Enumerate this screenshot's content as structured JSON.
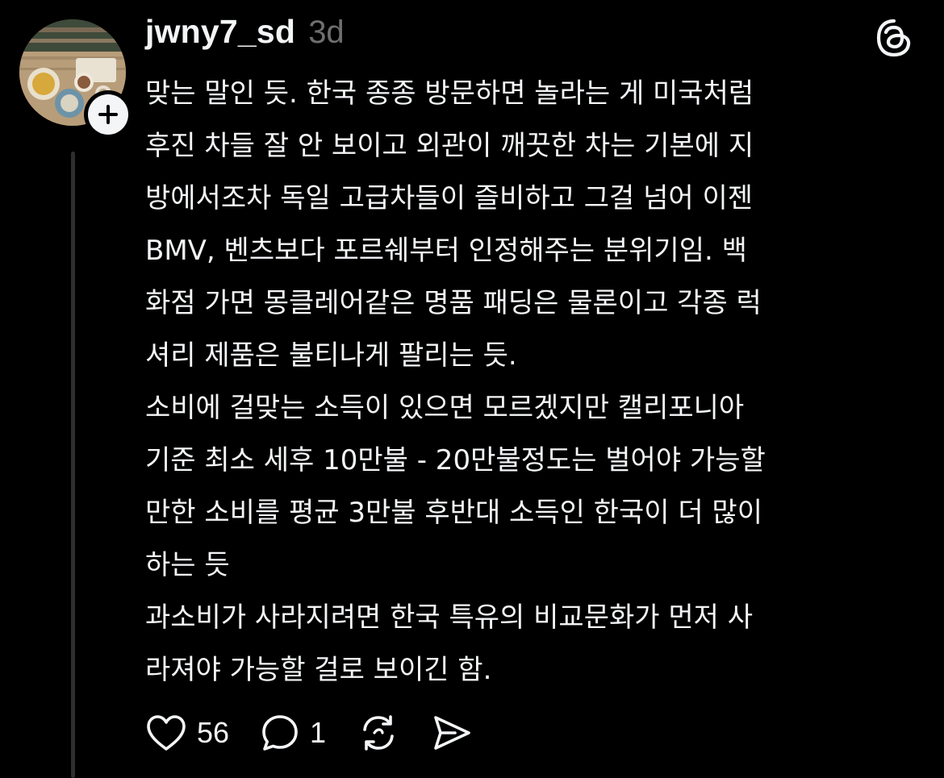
{
  "post": {
    "author": {
      "username": "jwny7_sd",
      "avatar": "food-table-photo"
    },
    "timestamp": "3d",
    "app_icon": "threads-logo-icon",
    "follow_icon": "plus-icon",
    "body": {
      "paragraphs": [
        "맞는 말인 듯. 한국 종종 방문하면 놀라는 게 미국처럼\n후진 차들 잘 안 보이고 외관이 깨끗한 차는 기본에 지\n방에서조차 독일 고급차들이 즐비하고 그걸 넘어 이젠\nBMV, 벤츠보다 포르쉐부터 인정해주는 분위기임. 백\n화점 가면 몽클레어같은 명품 패딩은 물론이고 각종 럭\n셔리 제품은 불티나게 팔리는 듯.",
        "소비에 걸맞는 소득이 있으면 모르겠지만 캘리포니아\n기준 최소 세후 10만불 - 20만불정도는 벌어야 가능할\n만한 소비를 평균 3만불 후반대 소득인 한국이 더 많이\n하는 듯",
        "과소비가 사라지려면 한국 특유의 비교문화가 먼저 사\n라져야 가능할 걸로 보이긴 함."
      ]
    },
    "actions": {
      "like": {
        "icon": "heart-icon",
        "count": "56"
      },
      "reply": {
        "icon": "comment-icon",
        "count": "1"
      },
      "repost": {
        "icon": "repost-icon"
      },
      "share": {
        "icon": "send-icon"
      }
    }
  },
  "colors": {
    "background": "#000000",
    "text": "#f3f5f7",
    "muted": "#6f6f6f",
    "thread_line": "#2e2e2e"
  }
}
